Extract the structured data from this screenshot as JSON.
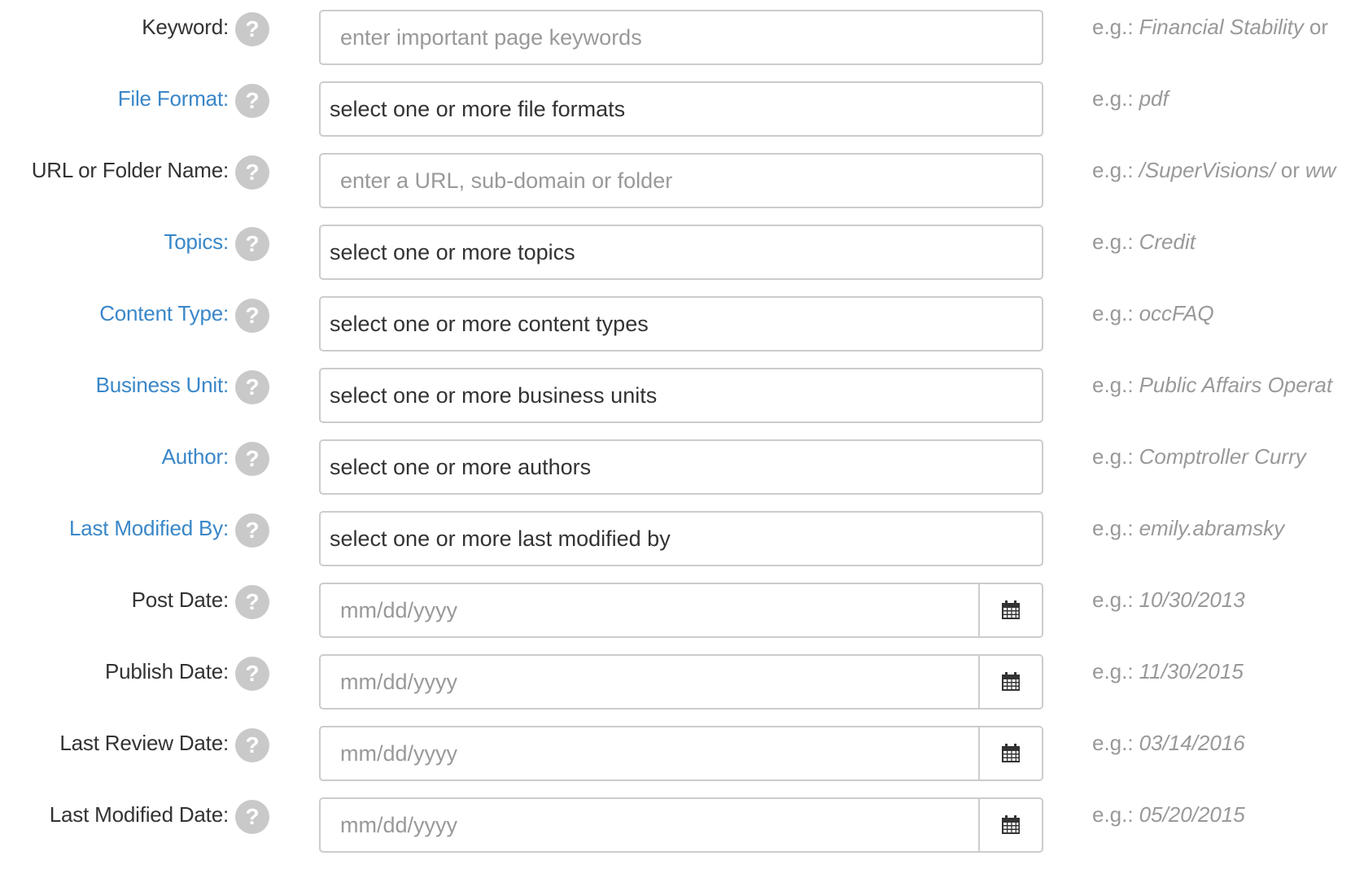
{
  "example_prefix": "e.g.:",
  "rows": [
    {
      "label": "Keyword:",
      "label_style": "plain",
      "field_kind": "text",
      "placeholder": "enter important page keywords",
      "example": "Financial Stability",
      "example_sep": "or",
      "example_tail": ""
    },
    {
      "label": "File Format:",
      "label_style": "link",
      "field_kind": "select",
      "value": "select one or more file formats",
      "example": "pdf",
      "example_sep": "",
      "example_tail": ""
    },
    {
      "label": "URL or Folder Name:",
      "label_style": "plain",
      "field_kind": "text",
      "placeholder": "enter a URL, sub-domain or folder",
      "example": "/SuperVisions/",
      "example_sep": "or",
      "example_tail": "ww"
    },
    {
      "label": "Topics:",
      "label_style": "link",
      "field_kind": "select",
      "value": "select one or more topics",
      "example": "Credit",
      "example_sep": "",
      "example_tail": ""
    },
    {
      "label": "Content Type:",
      "label_style": "link",
      "field_kind": "select",
      "value": "select one or more content types",
      "example": "occFAQ",
      "example_sep": "",
      "example_tail": ""
    },
    {
      "label": "Business Unit:",
      "label_style": "link",
      "field_kind": "select",
      "value": "select one or more business units",
      "example": "Public Affairs Operat",
      "example_sep": "",
      "example_tail": ""
    },
    {
      "label": "Author:",
      "label_style": "link",
      "field_kind": "select",
      "value": "select one or more authors",
      "example": "Comptroller Curry",
      "example_sep": "",
      "example_tail": ""
    },
    {
      "label": "Last Modified By:",
      "label_style": "link",
      "field_kind": "select",
      "value": "select one or more last modified by",
      "example": "emily.abramsky",
      "example_sep": "",
      "example_tail": ""
    },
    {
      "label": "Post Date:",
      "label_style": "plain",
      "field_kind": "date",
      "placeholder": "mm/dd/yyyy",
      "example": "10/30/2013",
      "example_sep": "",
      "example_tail": ""
    },
    {
      "label": "Publish Date:",
      "label_style": "plain",
      "field_kind": "date",
      "placeholder": "mm/dd/yyyy",
      "example": "11/30/2015",
      "example_sep": "",
      "example_tail": ""
    },
    {
      "label": "Last Review Date:",
      "label_style": "plain",
      "field_kind": "date",
      "placeholder": "mm/dd/yyyy",
      "example": "03/14/2016",
      "example_sep": "",
      "example_tail": ""
    },
    {
      "label": "Last Modified Date:",
      "label_style": "plain",
      "field_kind": "date",
      "placeholder": "mm/dd/yyyy",
      "example": "05/20/2015",
      "example_sep": "",
      "example_tail": ""
    }
  ],
  "help_glyph": "?",
  "icons": {
    "help": "question-circle-icon",
    "calendar": "calendar-icon"
  },
  "colors": {
    "link_label": "#3a87c8",
    "plain_label": "#333333",
    "border": "#cccccc",
    "placeholder": "#999999",
    "help_icon_bg": "#c9c9c9"
  }
}
